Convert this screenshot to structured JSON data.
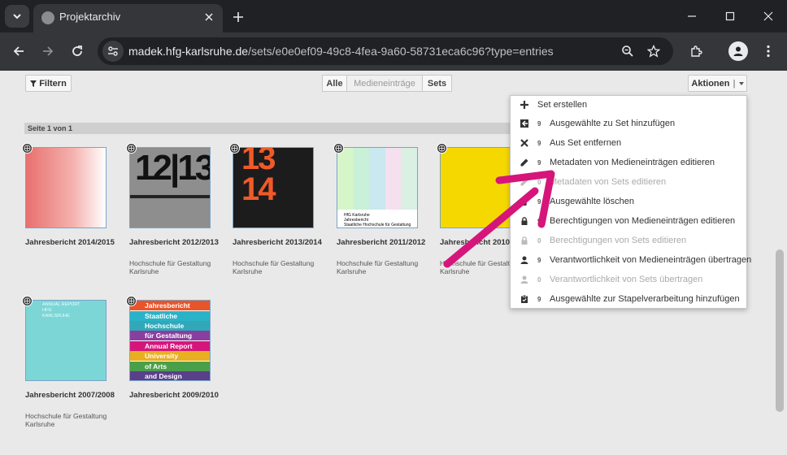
{
  "browser": {
    "tab_title": "Projektarchiv",
    "url_host": "madek.hfg-karlsruhe.de",
    "url_path": "/sets/e0e0ef09-49c8-4fea-9a60-58731eca6c96?type=entries"
  },
  "toolbar": {
    "filter_label": "Filtern",
    "segments": [
      "Alle",
      "Medieneinträge",
      "Sets"
    ],
    "actions_label": "Aktionen",
    "page_label": "Seite 1 von 1"
  },
  "cards": [
    {
      "title": "Jahresbericht 2014/2015",
      "author": ""
    },
    {
      "title": "Jahresbericht 2012/2013",
      "author": "Hochschule für Gestaltung Karlsruhe"
    },
    {
      "title": "Jahresbericht 2013/2014",
      "author": "Hochschule für Gestaltung Karlsruhe"
    },
    {
      "title": "Jahresbericht 2011/2012",
      "author": "Hochschule für Gestaltung Karlsruhe"
    },
    {
      "title": "Jahresbericht 2010/2011",
      "author": "Hochschule für Gestaltung Karlsruhe"
    },
    {
      "title": "Jahresbericht 2007/2008",
      "author": "Hochschule für Gestaltung Karlsruhe"
    },
    {
      "title": "Jahresbericht 2009/2010",
      "author": ""
    }
  ],
  "thumb_text": {
    "t2012": "12|13",
    "t2013": "13\n14",
    "t2011_line1": "HfG Karlsruhe",
    "t2011_line2": "Jahresbericht",
    "t2011_line3": "Staatliche Hochschule für Gestaltung",
    "t2007_line1": "Annual Report",
    "t2007_line2": "HfG",
    "t2007_line3": "Karlsruhe",
    "t2009_rows": [
      "Jahresbericht",
      "Staatliche",
      "Hochschule",
      "für Gestaltung",
      "Annual Report",
      "University",
      "of Arts",
      "and Design"
    ]
  },
  "menu": [
    {
      "icon": "plus-icon",
      "count": "",
      "label": "Set erstellen",
      "disabled": false
    },
    {
      "icon": "add-to-set-icon",
      "count": "9",
      "label": "Ausgewählte zu Set hinzufügen",
      "disabled": false
    },
    {
      "icon": "x-icon",
      "count": "9",
      "label": "Aus Set entfernen",
      "disabled": false
    },
    {
      "icon": "pencil-icon",
      "count": "9",
      "label": "Metadaten von Medieneinträgen editieren",
      "disabled": false
    },
    {
      "icon": "pencil-icon",
      "count": "0",
      "label": "Metadaten von Sets editieren",
      "disabled": true
    },
    {
      "icon": "trash-icon",
      "count": "9",
      "label": "Ausgewählte löschen",
      "disabled": false
    },
    {
      "icon": "lock-icon",
      "count": "9",
      "label": "Berechtigungen von Medieneinträgen editieren",
      "disabled": false
    },
    {
      "icon": "lock-icon",
      "count": "0",
      "label": "Berechtigungen von Sets editieren",
      "disabled": true
    },
    {
      "icon": "user-icon",
      "count": "9",
      "label": "Verantwortlichkeit von Medieneinträgen übertragen",
      "disabled": false
    },
    {
      "icon": "user-icon",
      "count": "0",
      "label": "Verantwortlichkeit von Sets übertragen",
      "disabled": true
    },
    {
      "icon": "clipboard-icon",
      "count": "9",
      "label": "Ausgewählte zur Stapelverarbeitung hinzufügen",
      "disabled": false
    }
  ],
  "colors": {
    "arrow": "#d6157b",
    "thumb_border": "#7aa3c9"
  }
}
